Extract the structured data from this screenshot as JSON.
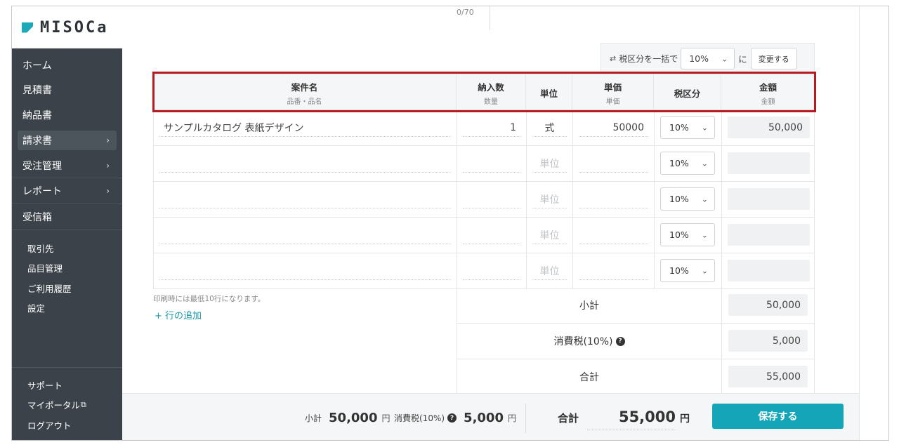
{
  "brand": {
    "name": "MISOCa",
    "accent": "#1ba8b8"
  },
  "sidebar": {
    "main_items": [
      {
        "label": "ホーム",
        "chevron": false
      },
      {
        "label": "見積書",
        "chevron": false
      },
      {
        "label": "納品書",
        "chevron": false
      },
      {
        "label": "請求書",
        "chevron": true,
        "active": true
      },
      {
        "label": "受注管理",
        "chevron": true
      },
      {
        "label": "レポート",
        "chevron": true
      },
      {
        "label": "受信箱",
        "chevron": false
      }
    ],
    "sub_items": [
      "取引先",
      "品目管理",
      "ご利用履歴",
      "設定"
    ],
    "bottom_items": [
      "サポート",
      "マイポータル",
      "ログアウト"
    ]
  },
  "form": {
    "char_counter": "0/70",
    "bulk_tax": {
      "label": "税区分を一括で",
      "selected": "10%",
      "suffix": "に",
      "button": "変更する"
    }
  },
  "table": {
    "headers": [
      {
        "title": "案件名",
        "sub": "品番・品名"
      },
      {
        "title": "納入数",
        "sub": "数量"
      },
      {
        "title": "単位",
        "sub": ""
      },
      {
        "title": "単価",
        "sub": "単価"
      },
      {
        "title": "税区分",
        "sub": ""
      },
      {
        "title": "金額",
        "sub": "金額"
      }
    ],
    "unit_placeholder": "単位",
    "rows": [
      {
        "name": "サンプルカタログ 表紙デザイン",
        "qty": "1",
        "unit": "式",
        "price": "50000",
        "tax": "10%",
        "amount": "50,000"
      },
      {
        "name": "",
        "qty": "",
        "unit": "",
        "price": "",
        "tax": "10%",
        "amount": ""
      },
      {
        "name": "",
        "qty": "",
        "unit": "",
        "price": "",
        "tax": "10%",
        "amount": ""
      },
      {
        "name": "",
        "qty": "",
        "unit": "",
        "price": "",
        "tax": "10%",
        "amount": ""
      },
      {
        "name": "",
        "qty": "",
        "unit": "",
        "price": "",
        "tax": "10%",
        "amount": ""
      }
    ],
    "print_note": "印刷時には最低10行になります。",
    "add_row": "+ 行の追加"
  },
  "summary": {
    "subtotal_label": "小計",
    "subtotal": "50,000",
    "tax_label": "消費税(10%)",
    "tax": "5,000",
    "total_label": "合計",
    "total": "55,000"
  },
  "footer": {
    "subtotal_label": "小計",
    "subtotal": "50,000",
    "tax_label": "消費税(10%)",
    "tax": "5,000",
    "yen": "円",
    "total_label": "合計",
    "total": "55,000",
    "save": "保存する"
  }
}
